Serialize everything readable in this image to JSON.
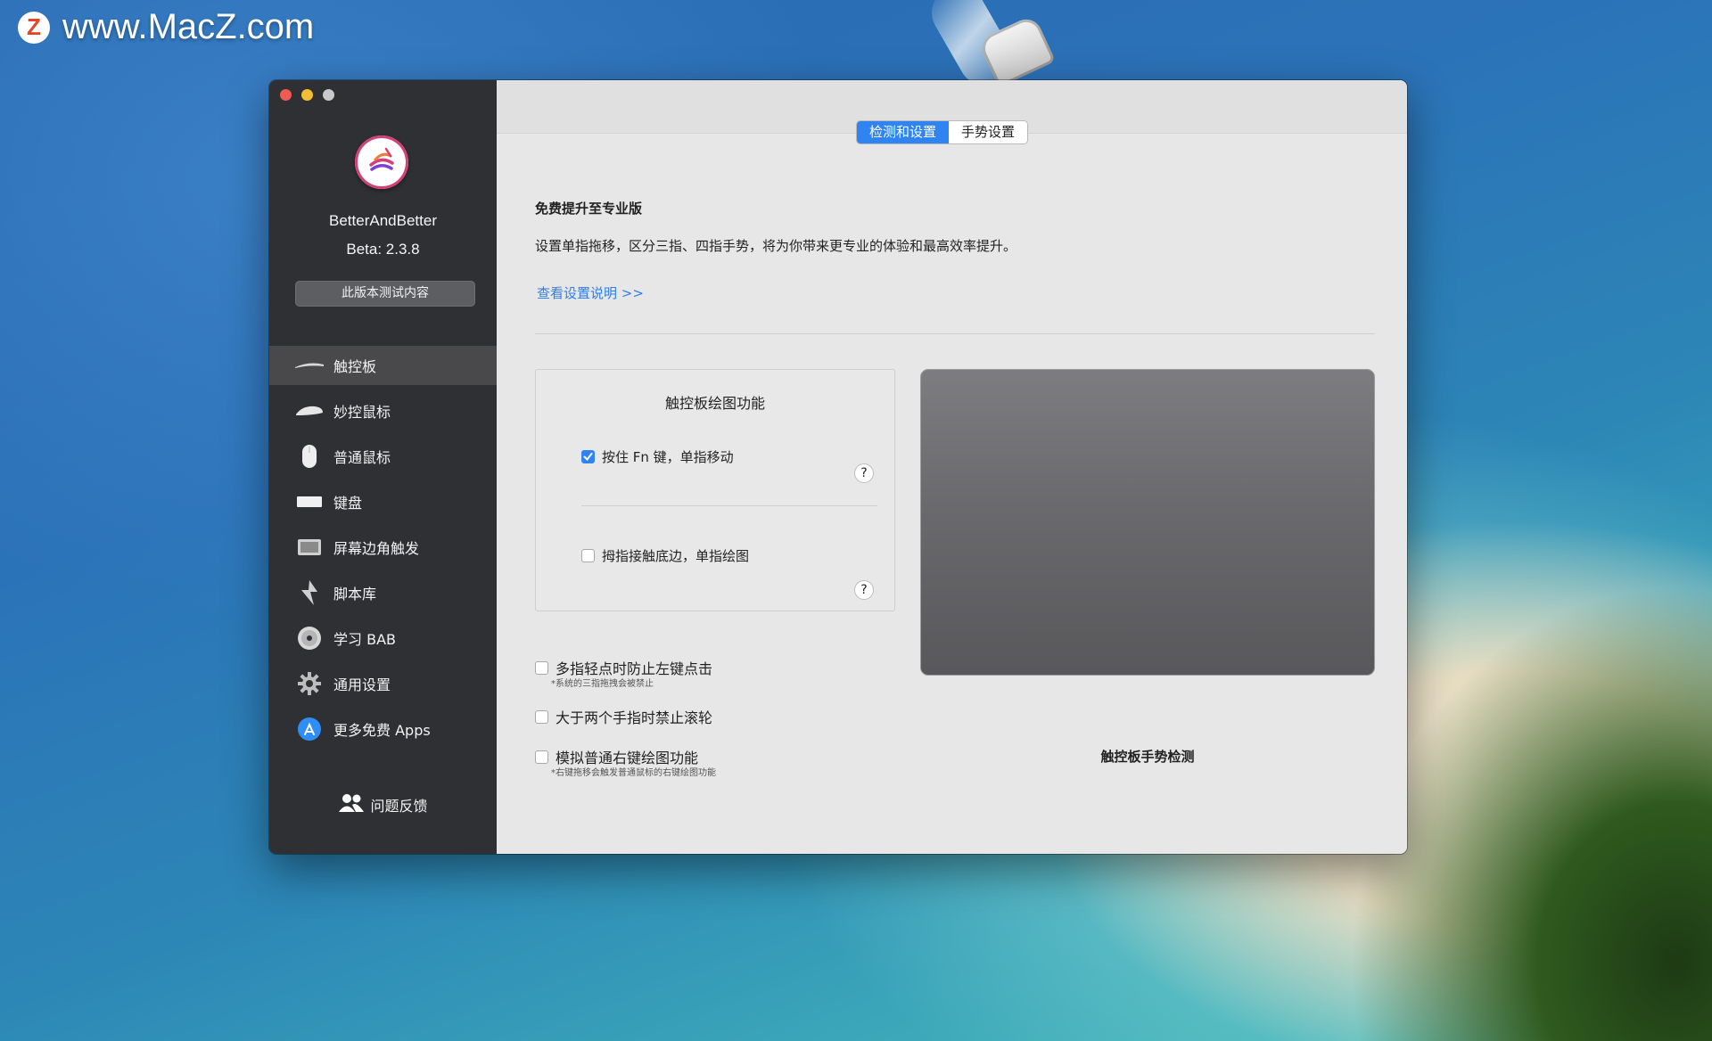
{
  "watermark": {
    "logo": "Z",
    "text": "www.MacZ.com"
  },
  "sidebar": {
    "app_name": "BetterAndBetter",
    "version": "Beta: 2.3.8",
    "beta_button": "此版本测试内容",
    "items": [
      {
        "label": "触控板",
        "icon": "trackpad-icon",
        "active": true
      },
      {
        "label": "妙控鼠标",
        "icon": "magic-mouse-icon",
        "active": false
      },
      {
        "label": "普通鼠标",
        "icon": "mouse-icon",
        "active": false
      },
      {
        "label": "键盘",
        "icon": "keyboard-icon",
        "active": false
      },
      {
        "label": "屏幕边角触发",
        "icon": "screen-corner-icon",
        "active": false
      },
      {
        "label": "脚本库",
        "icon": "script-icon",
        "active": false
      },
      {
        "label": "学习 BAB",
        "icon": "dvd-icon",
        "active": false
      },
      {
        "label": "通用设置",
        "icon": "gear-icon",
        "active": false
      },
      {
        "label": "更多免费 Apps",
        "icon": "app-store-icon",
        "active": false
      }
    ],
    "feedback": "问题反馈"
  },
  "tabs": [
    {
      "label": "检测和设置",
      "selected": true
    },
    {
      "label": "手势设置",
      "selected": false
    }
  ],
  "upgrade": {
    "title": "免费提升至专业版",
    "description": "设置单指拖移，区分三指、四指手势，将为你带来更专业的体验和最高效率提升。",
    "link": "查看设置说明 >>"
  },
  "draw_panel": {
    "title": "触控板绘图功能",
    "option1": {
      "label": "按住 Fn 键，单指移动",
      "checked": true
    },
    "option2": {
      "label": "拇指接触底边，单指绘图",
      "checked": false
    },
    "help": "?"
  },
  "options": [
    {
      "label": "多指轻点时防止左键点击",
      "note": "*系统的三指拖拽会被禁止",
      "checked": false
    },
    {
      "label": "大于两个手指时禁止滚轮",
      "note": "",
      "checked": false
    },
    {
      "label": "模拟普通右键绘图功能",
      "note": "*右键拖移会触发普通鼠标的右键绘图功能",
      "checked": false
    }
  ],
  "trackpad_label": "触控板手势检测",
  "colors": {
    "accent": "#2f84f2",
    "sidebar_bg": "#2f3033",
    "link": "#2f7ee8"
  }
}
